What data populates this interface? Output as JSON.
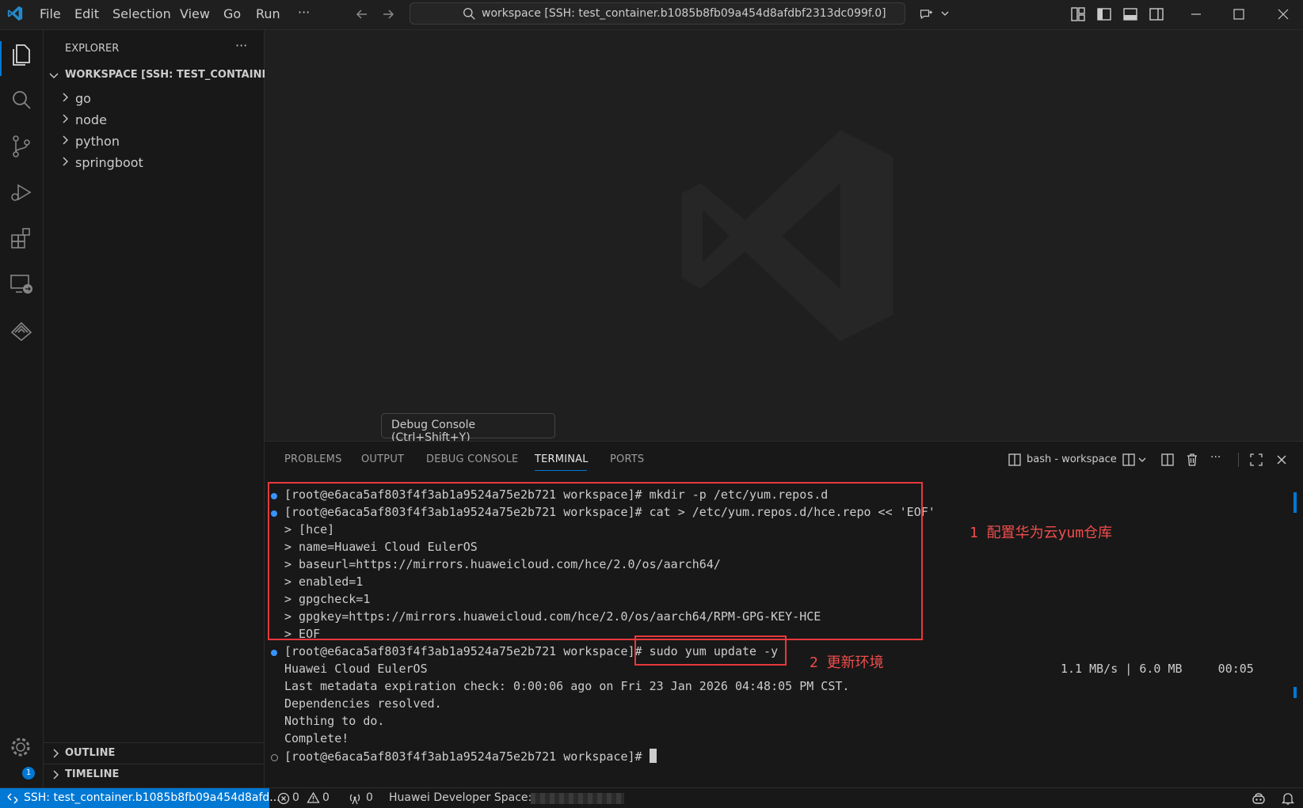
{
  "menu": {
    "file": "File",
    "edit": "Edit",
    "selection": "Selection",
    "view": "View",
    "go": "Go",
    "run": "Run",
    "more": "···"
  },
  "search": {
    "text": "workspace [SSH: test_container.b1085b8fb09a454d8afdbf2313dc099f.0]"
  },
  "explorer": {
    "title": "EXPLORER",
    "more": "···",
    "workspace_label": "WORKSPACE [SSH: TEST_CONTAINE...",
    "folders": [
      "go",
      "node",
      "python",
      "springboot"
    ],
    "outline": "OUTLINE",
    "timeline": "TIMELINE"
  },
  "tooltip": "Debug Console (Ctrl+Shift+Y)",
  "panel": {
    "tabs": [
      "PROBLEMS",
      "OUTPUT",
      "DEBUG CONSOLE",
      "TERMINAL",
      "PORTS"
    ],
    "active_tab": "TERMINAL",
    "terminal_name": "bash - workspace"
  },
  "terminal": {
    "lines": [
      "[root@e6aca5af803f4f3ab1a9524a75e2b721 workspace]# mkdir -p /etc/yum.repos.d",
      "[root@e6aca5af803f4f3ab1a9524a75e2b721 workspace]# cat > /etc/yum.repos.d/hce.repo << 'EOF'",
      "> [hce]",
      "> name=Huawei Cloud EulerOS",
      "> baseurl=https://mirrors.huaweicloud.com/hce/2.0/os/aarch64/",
      "> enabled=1",
      "> gpgcheck=1",
      "> gpgkey=https://mirrors.huaweicloud.com/hce/2.0/os/aarch64/RPM-GPG-KEY-HCE",
      "> EOF",
      "[root@e6aca5af803f4f3ab1a9524a75e2b721 workspace]# sudo yum update -y",
      "Huawei Cloud EulerOS",
      "Last metadata expiration check: 0:00:06 ago on Fri 23 Jan 2026 04:48:05 PM CST.",
      "Dependencies resolved.",
      "Nothing to do.",
      "Complete!",
      "[root@e6aca5af803f4f3ab1a9524a75e2b721 workspace]# "
    ],
    "download_rate": "1.1 MB/s | 6.0 MB     00:05"
  },
  "annotations": {
    "step1": "1 配置华为云yum仓库",
    "step2": "2 更新环境"
  },
  "status": {
    "remote": "SSH: test_container.b1085b8fb09a454d8afd...",
    "errors": "0",
    "warnings": "0",
    "ports": "0",
    "huawei": "Huawei Developer Space:",
    "settings_badge": "1"
  },
  "colors": {
    "accent": "#0078d4",
    "annotation_red": "#e8383d",
    "terminal_dot": "#3794ff"
  }
}
